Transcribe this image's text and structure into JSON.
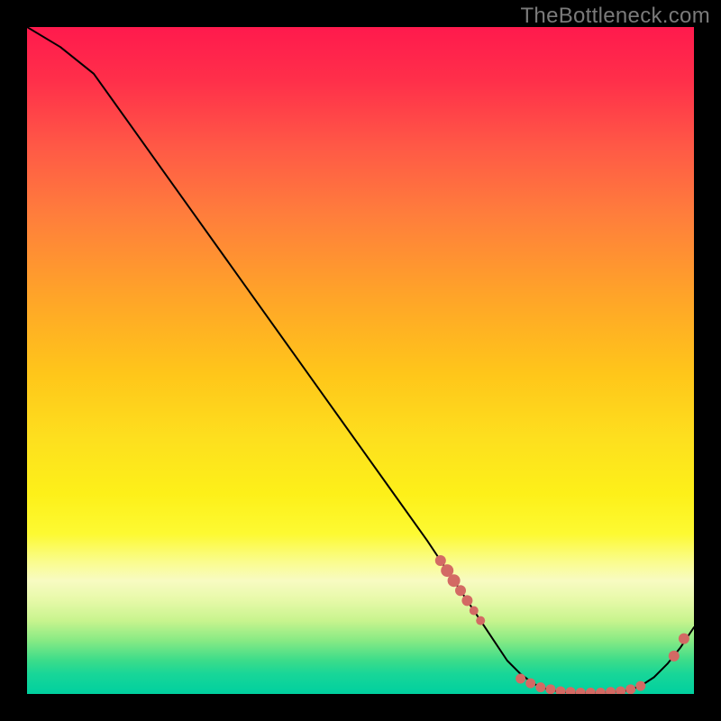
{
  "attribution": "TheBottleneck.com",
  "colors": {
    "page_bg": "#000000",
    "attribution_text": "#7a7a7a",
    "curve": "#000000",
    "marker": "#d36a64"
  },
  "chart_data": {
    "type": "line",
    "title": "",
    "xlabel": "",
    "ylabel": "",
    "xlim": [
      0,
      100
    ],
    "ylim": [
      0,
      100
    ],
    "grid": false,
    "legend": false,
    "x": [
      0,
      5,
      10,
      15,
      20,
      25,
      30,
      35,
      40,
      45,
      50,
      55,
      60,
      62,
      64,
      66,
      68,
      70,
      72,
      74,
      76,
      78,
      80,
      82,
      84,
      86,
      88,
      90,
      92,
      94,
      96,
      98,
      100
    ],
    "values": [
      100,
      97,
      93,
      86,
      79,
      72,
      65,
      58,
      51,
      44,
      37,
      30,
      23,
      20,
      17,
      14,
      11,
      8,
      5,
      3,
      1.5,
      0.7,
      0.3,
      0.2,
      0.2,
      0.2,
      0.3,
      0.5,
      1.2,
      2.5,
      4.5,
      7,
      10
    ],
    "marker_clusters": [
      {
        "comment": "descending cluster on the slope",
        "points": [
          {
            "x": 62,
            "y": 20,
            "r": 6
          },
          {
            "x": 63,
            "y": 18.5,
            "r": 7
          },
          {
            "x": 64,
            "y": 17,
            "r": 7
          },
          {
            "x": 65,
            "y": 15.5,
            "r": 6
          },
          {
            "x": 66,
            "y": 14,
            "r": 6
          },
          {
            "x": 67,
            "y": 12.5,
            "r": 5
          },
          {
            "x": 68,
            "y": 11,
            "r": 5
          }
        ]
      },
      {
        "comment": "valley floor cluster",
        "points": [
          {
            "x": 74,
            "y": 2.3,
            "r": 5.5
          },
          {
            "x": 75.5,
            "y": 1.6,
            "r": 5.5
          },
          {
            "x": 77,
            "y": 1.0,
            "r": 5.5
          },
          {
            "x": 78.5,
            "y": 0.7,
            "r": 5.5
          },
          {
            "x": 80,
            "y": 0.4,
            "r": 5.5
          },
          {
            "x": 81.5,
            "y": 0.3,
            "r": 5.5
          },
          {
            "x": 83,
            "y": 0.2,
            "r": 5.5
          },
          {
            "x": 84.5,
            "y": 0.2,
            "r": 5.5
          },
          {
            "x": 86,
            "y": 0.2,
            "r": 5.5
          },
          {
            "x": 87.5,
            "y": 0.3,
            "r": 5.5
          },
          {
            "x": 89,
            "y": 0.4,
            "r": 5.5
          },
          {
            "x": 90.5,
            "y": 0.7,
            "r": 5.5
          },
          {
            "x": 92,
            "y": 1.2,
            "r": 5.5
          }
        ]
      },
      {
        "comment": "two markers on rising segment",
        "points": [
          {
            "x": 97,
            "y": 5.7,
            "r": 6
          },
          {
            "x": 98.5,
            "y": 8.3,
            "r": 6
          }
        ]
      }
    ]
  }
}
